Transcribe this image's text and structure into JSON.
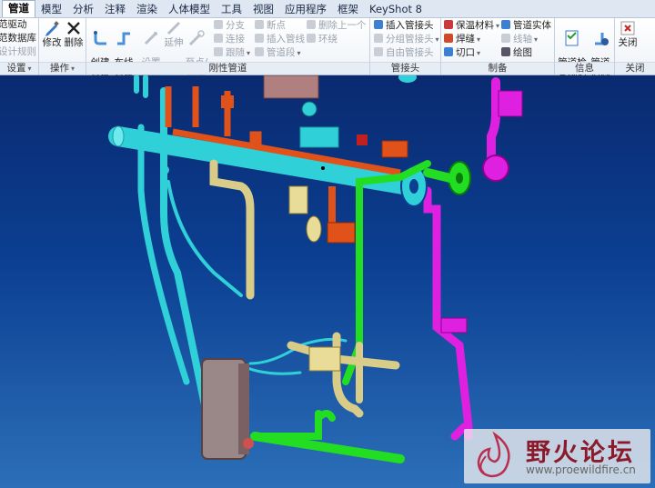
{
  "tabs": [
    "管道",
    "模型",
    "分析",
    "注释",
    "渲染",
    "人体模型",
    "工具",
    "视图",
    "应用程序",
    "框架",
    "KeyShot 8"
  ],
  "active_tab": "管道",
  "ribbon": {
    "setup": {
      "items": [
        "范驱动",
        "范数据库",
        "设计规则"
      ],
      "label": "设置"
    },
    "ops": {
      "edit": "修改",
      "delete": "删除",
      "label": "操作"
    },
    "rigid": {
      "create": "创建\n管道",
      "route": "布线\n管道",
      "setstart": "设置\n起点",
      "extend": "延伸",
      "topoint": "至点/\n端口",
      "col1": [
        "分支",
        "连接",
        "跟随"
      ],
      "col2": [
        "断点",
        "插入管线",
        "管道段"
      ],
      "col3": [
        "删除上一个",
        "环绕"
      ],
      "label": "刚性管道"
    },
    "fittings": {
      "items": [
        "插入管接头",
        "分组管接头",
        "自由管接头"
      ],
      "label": "管接头"
    },
    "fabrication": {
      "items": [
        "保温材料",
        "焊缝",
        "切口"
      ],
      "items2": [
        "管道实体",
        "线轴",
        "绘图"
      ],
      "label": "制备"
    },
    "info": {
      "check": "管道检\n查规则",
      "info": "管道\n信息",
      "label": "信息"
    },
    "close": {
      "btn": "关闭",
      "label": "关闭"
    }
  },
  "watermark": {
    "title": "野火论坛",
    "url": "www.proewildfire.cn"
  },
  "colors": {
    "viewport_top": "#0a2a70",
    "viewport_bottom": "#2c6fb8",
    "pipe_cyan": "#2fd0d8",
    "pipe_orange": "#e0521a",
    "pipe_green": "#22dd22",
    "pipe_magenta": "#e020e0",
    "pipe_yellow": "#d8cc88"
  }
}
